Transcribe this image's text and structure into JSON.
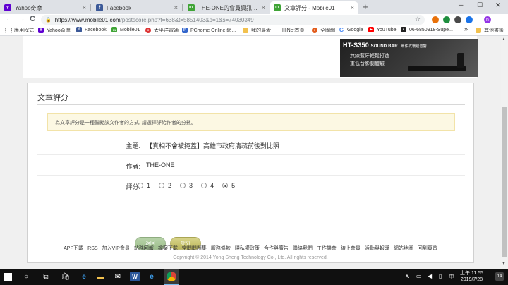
{
  "browser": {
    "tabs": [
      {
        "label": "Yahoo奇摩",
        "favicon": "Y",
        "color": "#5f01d1"
      },
      {
        "label": "Facebook",
        "favicon": "f",
        "color": "#3b5998"
      },
      {
        "label": "THE-ONE的會員資訊 - Mobile01",
        "favicon": "01",
        "color": "#3fa436"
      },
      {
        "label": "文章評分 - Mobile01",
        "favicon": "01",
        "color": "#3fa436"
      }
    ],
    "tab_close": "×",
    "new_tab": "+",
    "window_controls": {
      "minimize": "─",
      "maximize": "☐",
      "close": "✕"
    },
    "nav": {
      "back": "←",
      "forward": "→",
      "reload": "C"
    },
    "url": {
      "domain": "https://www.mobile01.com",
      "path": "/postscore.php?f=638&t=5851403&p=1&s=74030349"
    },
    "star": "☆",
    "profile_initial": "n",
    "menu": "⋮"
  },
  "bookmarks": [
    {
      "label": "應用程式",
      "color": "#666"
    },
    {
      "label": "Yahoo奇摩",
      "color": "#5f01d1",
      "icon": "Y"
    },
    {
      "label": "Facebook",
      "color": "#3b5998",
      "icon": "f"
    },
    {
      "label": "Mobile01",
      "color": "#3fa436",
      "icon": "01"
    },
    {
      "label": "太平洋電通",
      "color": "#d33",
      "icon": "●"
    },
    {
      "label": "PChome Online 網...",
      "color": "#3366cc",
      "icon": "P"
    },
    {
      "label": "我的最愛",
      "color": "#f2c14e",
      "icon": ""
    },
    {
      "label": "HiNet首頁",
      "color": "#0a6cb6",
      "icon": "─"
    },
    {
      "label": "全國網",
      "color": "#e25c1c",
      "icon": "●"
    },
    {
      "label": "Google",
      "color": "#4285f4",
      "icon": "G"
    },
    {
      "label": "YouTube",
      "color": "#ff0000",
      "icon": "▶"
    },
    {
      "label": "06-6850918-Supe...",
      "color": "#222",
      "icon": "▪"
    }
  ],
  "bookmarks_more": "»",
  "bookmarks_other": "其他書籤",
  "ad": {
    "headline": "HT-S350",
    "headline_tail": "SOUND BAR",
    "headline_small": "單件式環繞音響",
    "line1": "無線藍牙輕鬆打造",
    "line2": "重低音影劇體驗"
  },
  "page": {
    "title": "文章評分",
    "notice": "為文章評分是一種鼓勵該文作者的方式, 請選擇評給作者的分數。",
    "topic_label": "主題:",
    "topic_value": "【真相不會被掩蓋】高雄市政府清疏前後對比照",
    "author_label": "作者:",
    "author_value": "THE-ONE",
    "score_label": "評分:",
    "score_options": [
      "1",
      "2",
      "3",
      "4",
      "5"
    ],
    "selected_score": "5",
    "back_button": "返回",
    "submit_button": "評分"
  },
  "footer": {
    "links": [
      "APP下載",
      "RSS",
      "加入VIP會員",
      "站務回報",
      "檔案下載",
      "常問問題集",
      "服務條款",
      "隱私權政策",
      "合作與廣告",
      "聯絡我們",
      "工作機會",
      "線上會員",
      "活動與報導",
      "網站地圖",
      "回到頁首"
    ],
    "copyright": "Copyright © 2014 Yong Sheng Technology Co., Ltd. All rights reserved."
  },
  "taskbar": {
    "clock_top": "上午 11:55",
    "clock_bottom": "2019/7/28",
    "ime": "中",
    "notification_count": "14"
  }
}
